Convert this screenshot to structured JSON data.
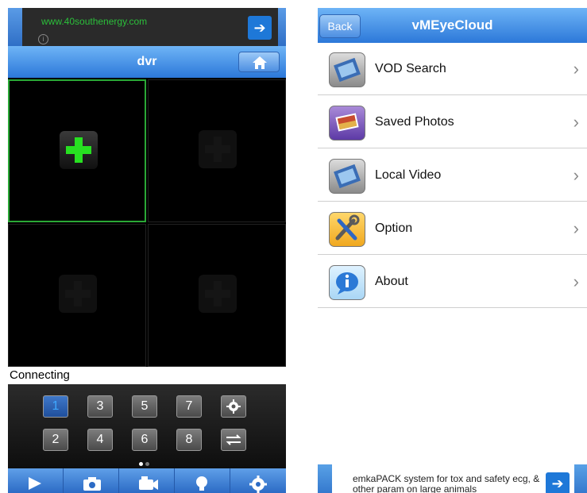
{
  "left_screen": {
    "ad": {
      "url_text": "www.40southenergy.com",
      "arrow_icon": "arrow-right-icon",
      "info_icon": "info-icon"
    },
    "header": {
      "title": "dvr",
      "home_icon": "home-icon"
    },
    "status_text": "Connecting",
    "channel_keys": [
      "1",
      "3",
      "5",
      "7",
      "2",
      "4",
      "6",
      "8"
    ],
    "selected_channel": "1",
    "page_indicator": {
      "pages": 2,
      "current": 1
    },
    "toolbar": [
      "play-icon",
      "camera-icon",
      "video-camera-icon",
      "lightbulb-icon",
      "gear-icon"
    ]
  },
  "right_screen": {
    "header": {
      "back_label": "Back",
      "title": "vMEyeCloud"
    },
    "menu": [
      {
        "label": "VOD Search",
        "icon": "film-reel-icon"
      },
      {
        "label": "Saved Photos",
        "icon": "photos-icon"
      },
      {
        "label": "Local Video",
        "icon": "film-reel-icon"
      },
      {
        "label": "Option",
        "icon": "tools-icon"
      },
      {
        "label": "About",
        "icon": "info-bubble-icon"
      }
    ],
    "ad": {
      "text": "emkaPACK system for tox and safety ecg, & other param on large animals",
      "arrow_icon": "arrow-right-icon"
    }
  },
  "colors": {
    "accent_blue": "#2c78d9",
    "active_green": "#2aa836"
  }
}
